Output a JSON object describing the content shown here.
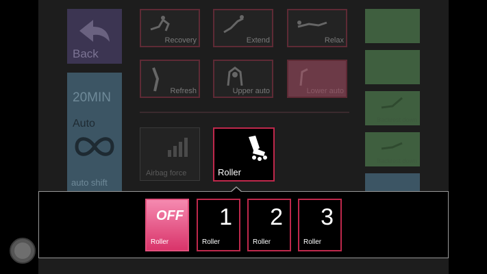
{
  "back": {
    "label": "Back"
  },
  "auto_panel": {
    "time": "20MIN",
    "mode": "Auto",
    "footer": "auto shift"
  },
  "programs": [
    {
      "label": "Recovery"
    },
    {
      "label": "Extend"
    },
    {
      "label": "Relax"
    },
    {
      "label": "Refresh"
    },
    {
      "label": "Upper auto"
    },
    {
      "label": "Lower auto"
    }
  ],
  "airbag": {
    "label": "Airbag force"
  },
  "roller": {
    "label": "Roller"
  },
  "side_buttons": [
    {
      "label": ""
    },
    {
      "label": ""
    },
    {
      "label": "Backrest down"
    },
    {
      "label": "Backrest down"
    },
    {
      "label": ""
    }
  ],
  "roller_options": [
    {
      "value": "OFF",
      "label": "Roller"
    },
    {
      "value": "1",
      "label": "Roller"
    },
    {
      "value": "2",
      "label": "Roller"
    },
    {
      "value": "3",
      "label": "Roller"
    }
  ],
  "colors": {
    "accent": "#c0284c",
    "active_top": "#f58ab0",
    "active_bottom": "#d9346a"
  }
}
